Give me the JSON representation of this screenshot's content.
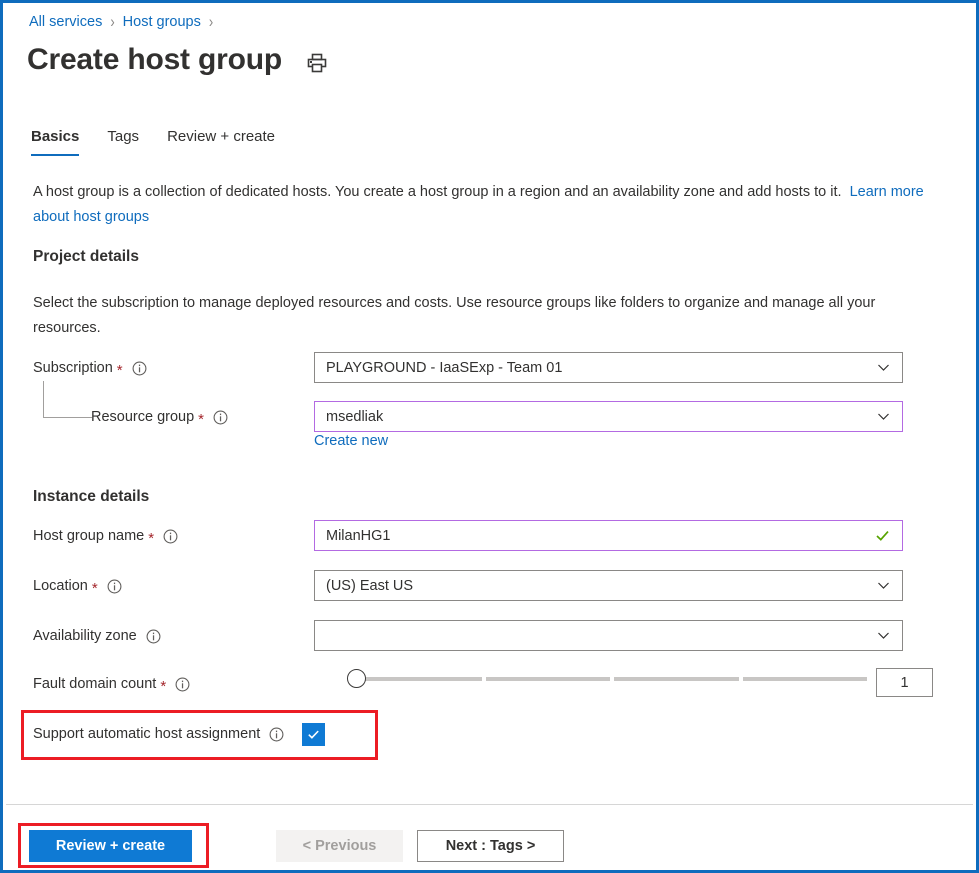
{
  "breadcrumb": {
    "items": [
      {
        "label": "All services"
      },
      {
        "label": "Host groups"
      }
    ],
    "separator": "›"
  },
  "header": {
    "title": "Create host group",
    "print_icon": "printer-icon"
  },
  "tabs": [
    {
      "label": "Basics",
      "active": true
    },
    {
      "label": "Tags",
      "active": false
    },
    {
      "label": "Review + create",
      "active": false
    }
  ],
  "intro": {
    "text": "A host group is a collection of dedicated hosts. You create a host group in a region and an availability zone and add hosts to it.",
    "link": "Learn more about host groups"
  },
  "project_details": {
    "heading": "Project details",
    "description": "Select the subscription to manage deployed resources and costs. Use resource groups like folders to organize and manage all your resources.",
    "subscription": {
      "label": "Subscription",
      "required": "*",
      "value": "PLAYGROUND - IaaSExp - Team 01",
      "info_icon": "info-icon",
      "chevron_icon": "chevron-down-icon"
    },
    "resource_group": {
      "label": "Resource group",
      "required": "*",
      "value": "msedliak",
      "info_icon": "info-icon",
      "chevron_icon": "chevron-down-icon",
      "create_new": "Create new"
    }
  },
  "instance_details": {
    "heading": "Instance details",
    "host_group_name": {
      "label": "Host group name",
      "required": "*",
      "value": "MilanHG1",
      "info_icon": "info-icon",
      "valid_icon": "checkmark-icon"
    },
    "location": {
      "label": "Location",
      "required": "*",
      "value": "(US) East US",
      "info_icon": "info-icon",
      "chevron_icon": "chevron-down-icon"
    },
    "availability_zone": {
      "label": "Availability zone",
      "value": "",
      "info_icon": "info-icon",
      "chevron_icon": "chevron-down-icon"
    },
    "fault_domain_count": {
      "label": "Fault domain count",
      "required": "*",
      "value": "1",
      "min": 1,
      "max": 5,
      "segments": 4,
      "info_icon": "info-icon"
    },
    "auto_host_assignment": {
      "label": "Support automatic host assignment",
      "checked": true,
      "info_icon": "info-icon",
      "check_icon": "checkmark-icon"
    }
  },
  "footer": {
    "review_create": "Review + create",
    "previous": "< Previous",
    "next": "Next : Tags >"
  },
  "colors": {
    "accent": "#0f6cbd",
    "primary_button": "#0f7ad4",
    "required_asterisk": "#a4262c",
    "focused_border": "#b36ae2",
    "valid_check": "#57a300",
    "annotation": "#ec1c24",
    "page_border": "#0f6cbd"
  }
}
